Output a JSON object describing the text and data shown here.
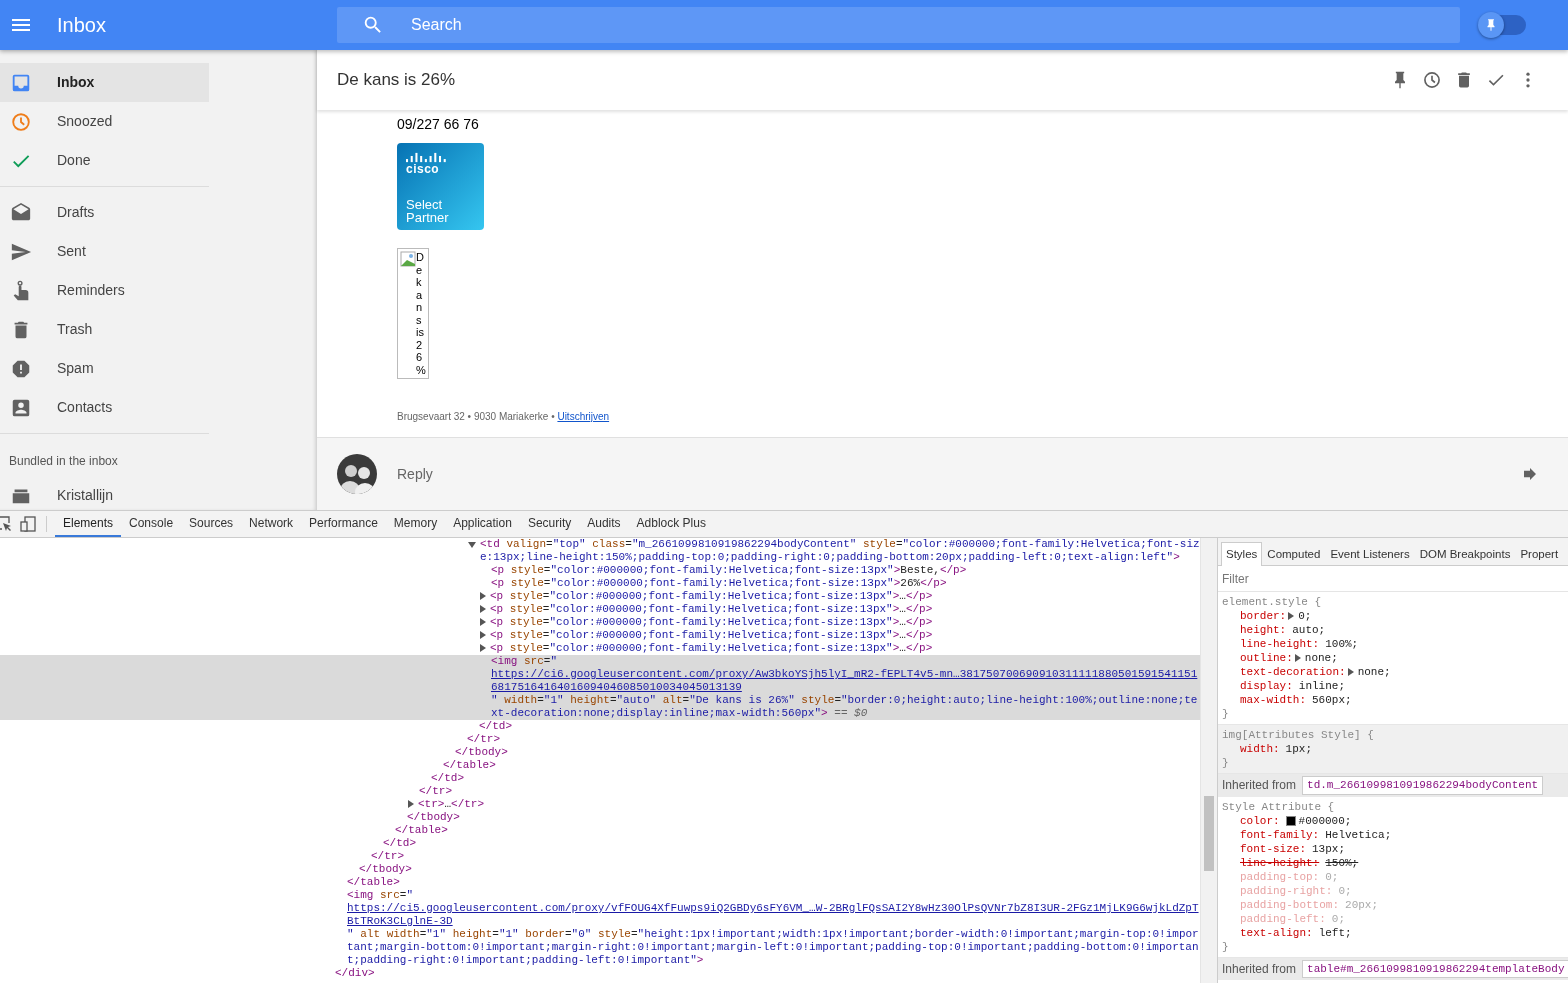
{
  "app_bar": {
    "title": "Inbox",
    "search": {
      "placeholder": "Search"
    },
    "pin_toggle": {
      "on": false
    }
  },
  "sidebar": {
    "groups": [
      [
        {
          "label": "Inbox",
          "selected": true
        },
        {
          "label": "Snoozed",
          "selected": false
        },
        {
          "label": "Done",
          "selected": false
        }
      ],
      [
        {
          "label": "Drafts",
          "selected": false
        },
        {
          "label": "Sent",
          "selected": false
        },
        {
          "label": "Reminders",
          "selected": false
        },
        {
          "label": "Trash",
          "selected": false
        },
        {
          "label": "Spam",
          "selected": false
        },
        {
          "label": "Contacts",
          "selected": false
        }
      ]
    ],
    "bundled_heading": "Bundled in the inbox",
    "bundles": [
      {
        "label": "Kristallijn",
        "selected": false
      }
    ]
  },
  "email": {
    "subject": "De kans is 26%",
    "phone": "09/227 66 76",
    "partner_logo": {
      "brand": "cisco",
      "caption": "Select Partner"
    },
    "broken_image": {
      "alt": "De kans is 26%"
    },
    "footer": {
      "address": "Brugsevaart 32 • 9030 Mariakerke •",
      "link": "Uitschrijven"
    },
    "reply": {
      "label": "Reply"
    }
  },
  "devtools": {
    "tabs": [
      {
        "label": "Elements",
        "selected": true
      },
      {
        "label": "Console",
        "selected": false
      },
      {
        "label": "Sources",
        "selected": false
      },
      {
        "label": "Network",
        "selected": false
      },
      {
        "label": "Performance",
        "selected": false
      },
      {
        "label": "Memory",
        "selected": false
      },
      {
        "label": "Application",
        "selected": false
      },
      {
        "label": "Security",
        "selected": false
      },
      {
        "label": "Audits",
        "selected": false
      },
      {
        "label": "Adblock Plus",
        "selected": false
      }
    ],
    "dom_tree": {
      "close": "</div>",
      "children": [
        {
          "close": "</table>",
          "children": [
            {
              "close": "</tbody>",
              "children": [
                {
                  "close": "</tr>",
                  "children": [
                    {
                      "close": "</td>",
                      "children": [
                        {
                          "close": "</table>",
                          "children": [
                            {
                              "close": "</tbody>",
                              "children": [
                                {
                                  "close": "</tr>",
                                  "children": [
                                    {
                                      "close": "</td>",
                                      "children": [
                                        {
                                          "close": "</table>",
                                          "children": [
                                            {
                                              "close": "</tbody>",
                                              "children": [
                                                {
                                                  "close": "</tr>",
                                                  "children": [
                                                    {
                                                      "open": "<td valign=\"top\" class=\"m_2661099810919862294bodyContent\" style=\"color:#000000;font-family:Helvetica;font-size:13px;line-height:150%;padding-top:0;padding-right:0;padding-bottom:20px;padding-left:0;text-align:left\">",
                                                      "expandable": true,
                                                      "expanded": true,
                                                      "selected": false,
                                                      "close": "</td>",
                                                      "children": [
                                                        {
                                                          "open": "<p style=\"color:#000000;font-family:Helvetica;font-size:13px\">Beste,</p>",
                                                          "expandable": false,
                                                          "selected": false
                                                        },
                                                        {
                                                          "open": "<p style=\"color:#000000;font-family:Helvetica;font-size:13px\">26%</p>",
                                                          "expandable": false,
                                                          "selected": false
                                                        },
                                                        {
                                                          "open": "<p style=\"color:#000000;font-family:Helvetica;font-size:13px\">…</p>",
                                                          "expandable": true,
                                                          "expanded": false,
                                                          "selected": false
                                                        },
                                                        {
                                                          "open": "<p style=\"color:#000000;font-family:Helvetica;font-size:13px\">…</p>",
                                                          "expandable": true,
                                                          "expanded": false,
                                                          "selected": false
                                                        },
                                                        {
                                                          "open": "<p style=\"color:#000000;font-family:Helvetica;font-size:13px\">…</p>",
                                                          "expandable": true,
                                                          "expanded": false,
                                                          "selected": false
                                                        },
                                                        {
                                                          "open": "<p style=\"color:#000000;font-family:Helvetica;font-size:13px\">…</p>",
                                                          "expandable": true,
                                                          "expanded": false,
                                                          "selected": false
                                                        },
                                                        {
                                                          "open": "<p style=\"color:#000000;font-family:Helvetica;font-size:13px\">…</p>",
                                                          "expandable": true,
                                                          "expanded": false,
                                                          "selected": false
                                                        },
                                                        {
                                                          "open": "<img src=\"https://ci6.googleusercontent.com/proxy/Aw3bkoYSjh5lyI_mR2-fEPLT4v5-mn…38175070069091031111188050159154115168175164164016094046085010034045013139\" width=\"1\" height=\"auto\" alt=\"De kans is 26%\" style=\"border:0;height:auto;line-height:100%;outline:none;text-decoration:none;display:inline;max-width:560px\">",
                                                          "link": true,
                                                          "expandable": false,
                                                          "selected": true,
                                                          "suffix": "== $0"
                                                        }
                                                      ]
                                                    }
                                                  ]
                                                }
                                              ]
                                            }
                                          ]
                                        }
                                      ]
                                    }
                                  ]
                                },
                                {
                                  "open": "<tr>…</tr>",
                                  "expandable": true,
                                  "expanded": false,
                                  "selected": false
                                }
                              ]
                            }
                          ]
                        }
                      ]
                    }
                  ]
                }
              ]
            }
          ]
        },
        {
          "open": "<img src=\"https://ci5.googleusercontent.com/proxy/vfFOUG4XfFuwps9iQ2GBDy6sFY6VM_…W-2BRglFQsSAI2Y8wHz30OlPsQVNr7bZ8I3UR-2FGz1MjLK9G6wjkLdZpTBtTRoK3CLglnE-3D\" alt width=\"1\" height=\"1\" border=\"0\" style=\"height:1px!important;width:1px!important;border-width:0!important;margin-top:0!important;margin-bottom:0!important;margin-right:0!important;margin-left:0!important;padding-top:0!important;padding-bottom:0!important;padding-right:0!important;padding-left:0!important\">",
          "link": true,
          "expandable": false,
          "selected": false
        }
      ]
    },
    "styles": {
      "tabs": [
        {
          "label": "Styles",
          "selected": true
        },
        {
          "label": "Computed",
          "selected": false
        },
        {
          "label": "Event Listeners",
          "selected": false
        },
        {
          "label": "DOM Breakpoints",
          "selected": false
        },
        {
          "label": "Propert",
          "selected": false
        }
      ],
      "filter": {
        "placeholder": "Filter"
      },
      "sections": [
        {
          "kind": "rule",
          "selector": "element.style {",
          "shaded": false,
          "close": "}",
          "props": [
            {
              "name": "border:",
              "value": "0;",
              "expandable": true,
              "overridden": false,
              "inactive": false
            },
            {
              "name": "height:",
              "value": "auto;",
              "expandable": false,
              "overridden": false,
              "inactive": false
            },
            {
              "name": "line-height:",
              "value": "100%;",
              "expandable": false,
              "overridden": false,
              "inactive": false
            },
            {
              "name": "outline:",
              "value": "none;",
              "expandable": true,
              "overridden": false,
              "inactive": false
            },
            {
              "name": "text-decoration:",
              "value": "none;",
              "expandable": true,
              "overridden": false,
              "inactive": false
            },
            {
              "name": "display:",
              "value": "inline;",
              "expandable": false,
              "overridden": false,
              "inactive": false
            },
            {
              "name": "max-width:",
              "value": "560px;",
              "expandable": false,
              "overridden": false,
              "inactive": false
            }
          ]
        },
        {
          "kind": "rule",
          "selector": "img[Attributes Style] {",
          "shaded": true,
          "close": "}",
          "props": [
            {
              "name": "width:",
              "value": "1px;",
              "expandable": false,
              "overridden": false,
              "inactive": false
            }
          ]
        },
        {
          "kind": "inherited",
          "label": "Inherited from",
          "source": "td.m_2661099810919862294bodyContent"
        },
        {
          "kind": "rule",
          "selector": "Style Attribute {",
          "shaded": false,
          "close": "}",
          "props": [
            {
              "name": "color:",
              "value": "#000000;",
              "expandable": false,
              "overridden": false,
              "inactive": false,
              "color": "#000000"
            },
            {
              "name": "font-family:",
              "value": "Helvetica;",
              "expandable": false,
              "overridden": false,
              "inactive": false
            },
            {
              "name": "font-size:",
              "value": "13px;",
              "expandable": false,
              "overridden": false,
              "inactive": false
            },
            {
              "name": "line-height:",
              "value": "150%;",
              "expandable": false,
              "overridden": true,
              "inactive": false
            },
            {
              "name": "padding-top:",
              "value": "0;",
              "expandable": false,
              "overridden": false,
              "inactive": true
            },
            {
              "name": "padding-right:",
              "value": "0;",
              "expandable": false,
              "overridden": false,
              "inactive": true
            },
            {
              "name": "padding-bottom:",
              "value": "20px;",
              "expandable": false,
              "overridden": false,
              "inactive": true
            },
            {
              "name": "padding-left:",
              "value": "0;",
              "expandable": false,
              "overridden": false,
              "inactive": true
            },
            {
              "name": "text-align:",
              "value": "left;",
              "expandable": false,
              "overridden": false,
              "inactive": false
            }
          ]
        },
        {
          "kind": "inherited",
          "label": "Inherited from",
          "source": "table#m_2661099810919862294templateBody"
        }
      ]
    }
  }
}
